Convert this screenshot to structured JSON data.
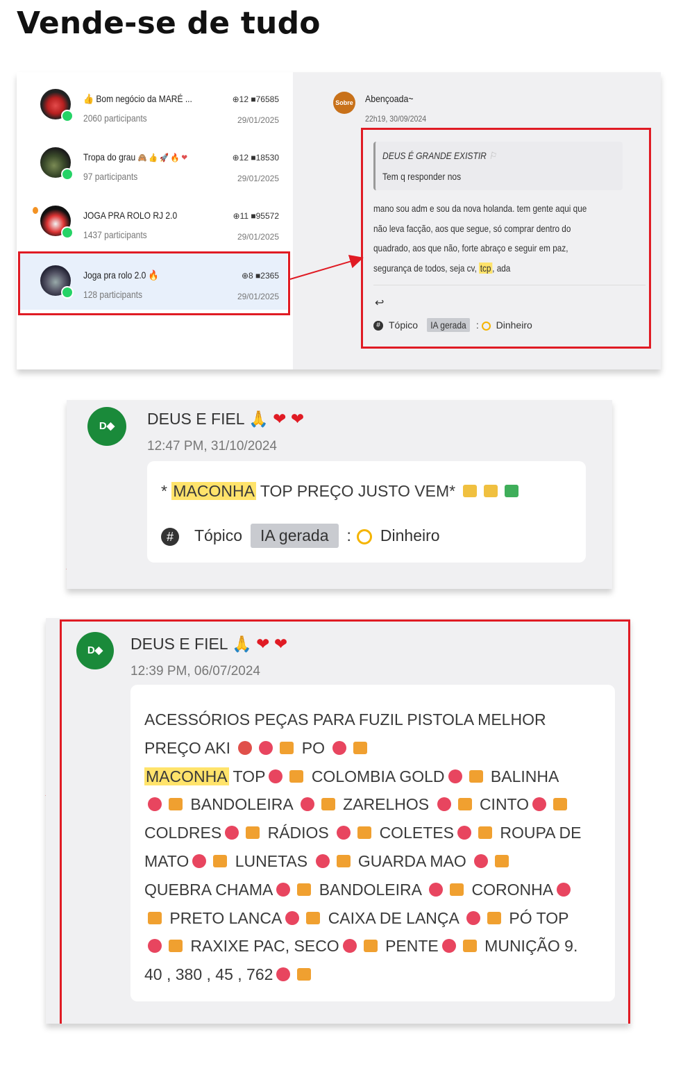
{
  "heading": "Vende-se de tudo",
  "panel1": {
    "chats": [
      {
        "name": "Bom negócio da MARÉ ...",
        "prefix_emoji": "👍",
        "participants": "2060 participants",
        "topics": "12",
        "messages": "76585",
        "date": "29/01/2025"
      },
      {
        "name": "Tropa do grau",
        "suffix_emoji": "🙈 👍 🚀 🔥 ❤",
        "participants": "97 participants",
        "topics": "12",
        "messages": "18530",
        "date": "29/01/2025"
      },
      {
        "name": "JOGA PRA ROLO RJ 2.0",
        "participants": "1437 participants",
        "topics": "11",
        "messages": "95572",
        "date": "29/01/2025"
      },
      {
        "name": "Joga pra rolo 2.0",
        "suffix_emoji": "🔥",
        "participants": "128 participants",
        "topics": "8",
        "messages": "2365",
        "date": "29/01/2025"
      }
    ],
    "message": {
      "avatar_label": "Sobre",
      "sender": "Abençoada~",
      "time": "22h19, 30/09/2024",
      "quote_author": "DEUS É GRANDE EXISTIR",
      "quote_text": "Tem q responder nos",
      "lines": [
        "mano sou adm e sou da nova holanda. tem gente aqui que",
        "não leva facção, aos que segue, só comprar dentro do",
        "quadrado, aos que não, forte abraço e seguir em paz,"
      ],
      "last_line_before": "segurança de todos, seja cv, ",
      "last_line_highlight": "tcp",
      "last_line_after": ", ada",
      "reply_icon": "↩",
      "topic_label": "Tópico",
      "chip": "IA gerada",
      "category": "Dinheiro"
    }
  },
  "panel2": {
    "avatar_label": "D◆",
    "sender": "DEUS E FIEL",
    "sender_emoji": "🙏",
    "time": "12:47 PM, 31/10/2024",
    "msg_prefix": "* ",
    "highlight": "MACONHA",
    "msg_rest": " TOP PREÇO JUSTO VEM*",
    "topic_label": "Tópico",
    "chip": "IA gerada",
    "category": "Dinheiro"
  },
  "panel3": {
    "avatar_label": "D◆",
    "sender": "DEUS E FIEL",
    "sender_emoji": "🙏",
    "time": "12:39 PM, 06/07/2024",
    "l1": "ACESSÓRIOS PEÇAS PARA FUZIL PISTOLA MELHOR",
    "l2a": "PREÇO AKI",
    "l2b": "PO",
    "l3hl": "MACONHA",
    "l3a": "TOP",
    "l3b": "COLOMBIA GOLD",
    "l3c": "BALINHA",
    "l4a": "BANDOLEIRA",
    "l4b": "ZARELHOS",
    "l4c": "CINTO",
    "l5a": "COLDRES",
    "l5b": "RÁDIOS",
    "l5c": "COLETES",
    "l5d": "ROUPA DE",
    "l6a": "MATO",
    "l6b": "LUNETAS",
    "l6c": "GUARDA MAO",
    "l7a": "QUEBRA CHAMA",
    "l7b": "BANDOLEIRA",
    "l7c": "CORONHA",
    "l8a": "PRETO LANCA",
    "l8b": "CAIXA DE LANÇA",
    "l8c": "PÓ TOP",
    "l9a": "RAXIXE PAC, SECO",
    "l9b": "PENTE",
    "l9c": "MUNIÇÃO 9.",
    "l10": "40 , 380 , 45 , 762"
  }
}
